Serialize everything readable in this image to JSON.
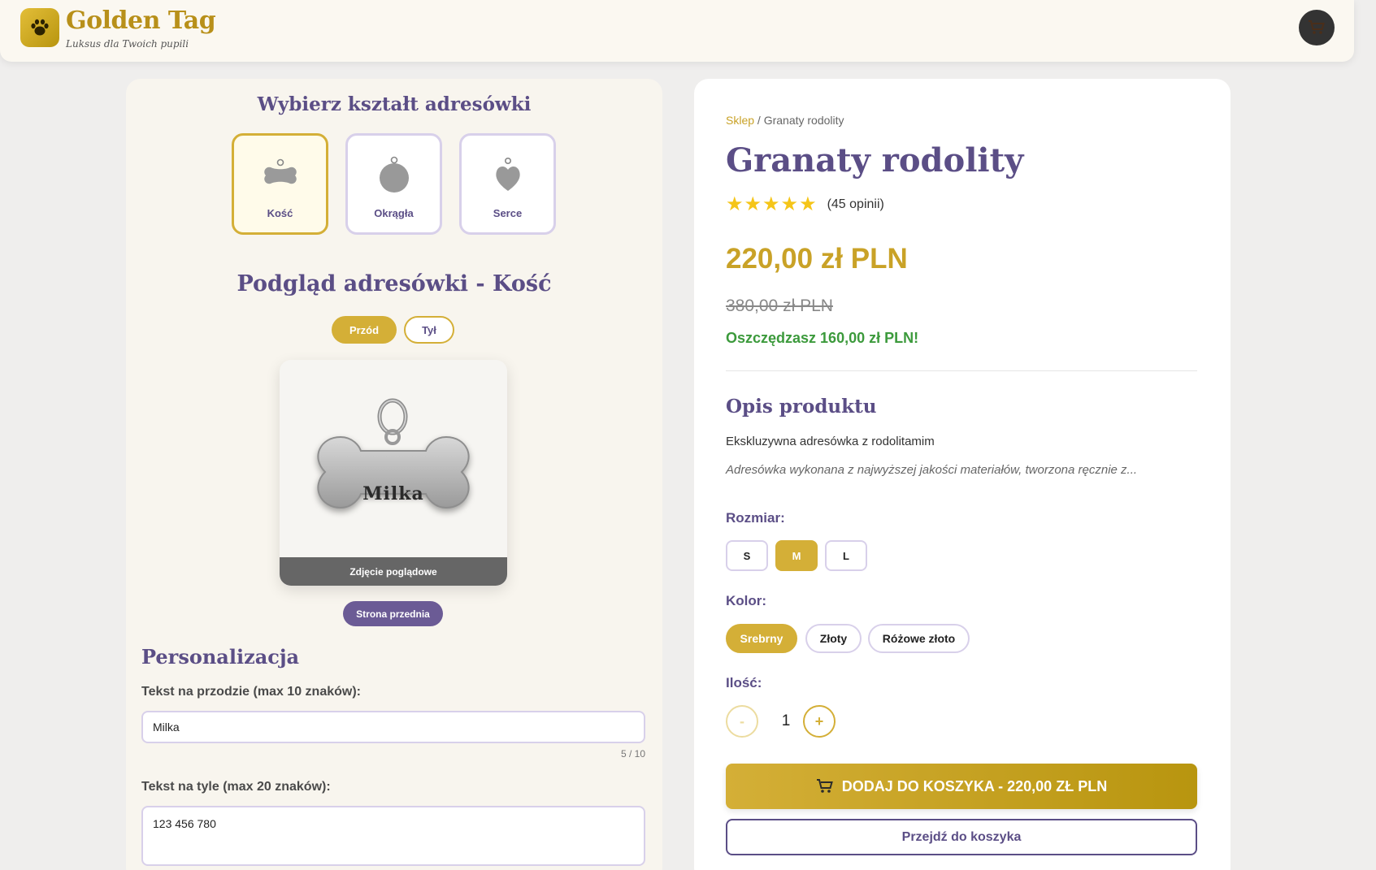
{
  "header": {
    "brand_name": "Golden Tag",
    "tagline": "Luksus dla Twoich pupili"
  },
  "customizer": {
    "shape_title": "Wybierz kształt adresówki",
    "shapes": [
      {
        "label": "Kość",
        "selected": true
      },
      {
        "label": "Okrągła",
        "selected": false
      },
      {
        "label": "Serce",
        "selected": false
      }
    ],
    "preview_title": "Podgląd adresówki - Kość",
    "side_tabs": [
      {
        "label": "Przód",
        "selected": true
      },
      {
        "label": "Tył",
        "selected": false
      }
    ],
    "tag_engraving": "Milka",
    "tag_caption": "Zdjęcie poglądowe",
    "side_badge": "Strona przednia"
  },
  "personalization": {
    "title": "Personalizacja",
    "front_label": "Tekst na przodzie (max 10 znaków):",
    "front_value": "Milka",
    "front_counter": "5 / 10",
    "back_label": "Tekst na tyle (max 20 znaków):",
    "back_value": "123 456 780"
  },
  "product": {
    "breadcrumb_link": "Sklep",
    "breadcrumb_sep": " / ",
    "breadcrumb_current": "Granaty rodolity",
    "title": "Granaty rodolity",
    "rating": 5,
    "reviews": "(45 opinii)",
    "price": "220,00 zł PLN",
    "old_price": "380,00 zł PLN",
    "savings": "Oszczędzasz 160,00 zł PLN!",
    "description_title": "Opis produktu",
    "description_short": "Ekskluzywna adresówka z rodolitamim",
    "description_long": "Adresówka wykonana z najwyższej jakości materiałów, tworzona ręcznie z..."
  },
  "options": {
    "size_label": "Rozmiar:",
    "sizes": [
      {
        "label": "S",
        "selected": false
      },
      {
        "label": "M",
        "selected": true
      },
      {
        "label": "L",
        "selected": false
      }
    ],
    "color_label": "Kolor:",
    "colors": [
      {
        "label": "Srebrny",
        "selected": true
      },
      {
        "label": "Złoty",
        "selected": false
      },
      {
        "label": "Różowe złoto",
        "selected": false
      }
    ],
    "qty_label": "Ilość:",
    "qty_minus": "-",
    "qty_plus": "+",
    "qty_value": "1"
  },
  "actions": {
    "add_to_cart": "DODAJ DO KOSZYKA - 220,00 ZŁ PLN",
    "go_to_cart": "Przejdź do koszyka"
  },
  "colors": {
    "gold": "#d4af37",
    "purple": "#5b4e86",
    "green": "#3c9a3c"
  }
}
